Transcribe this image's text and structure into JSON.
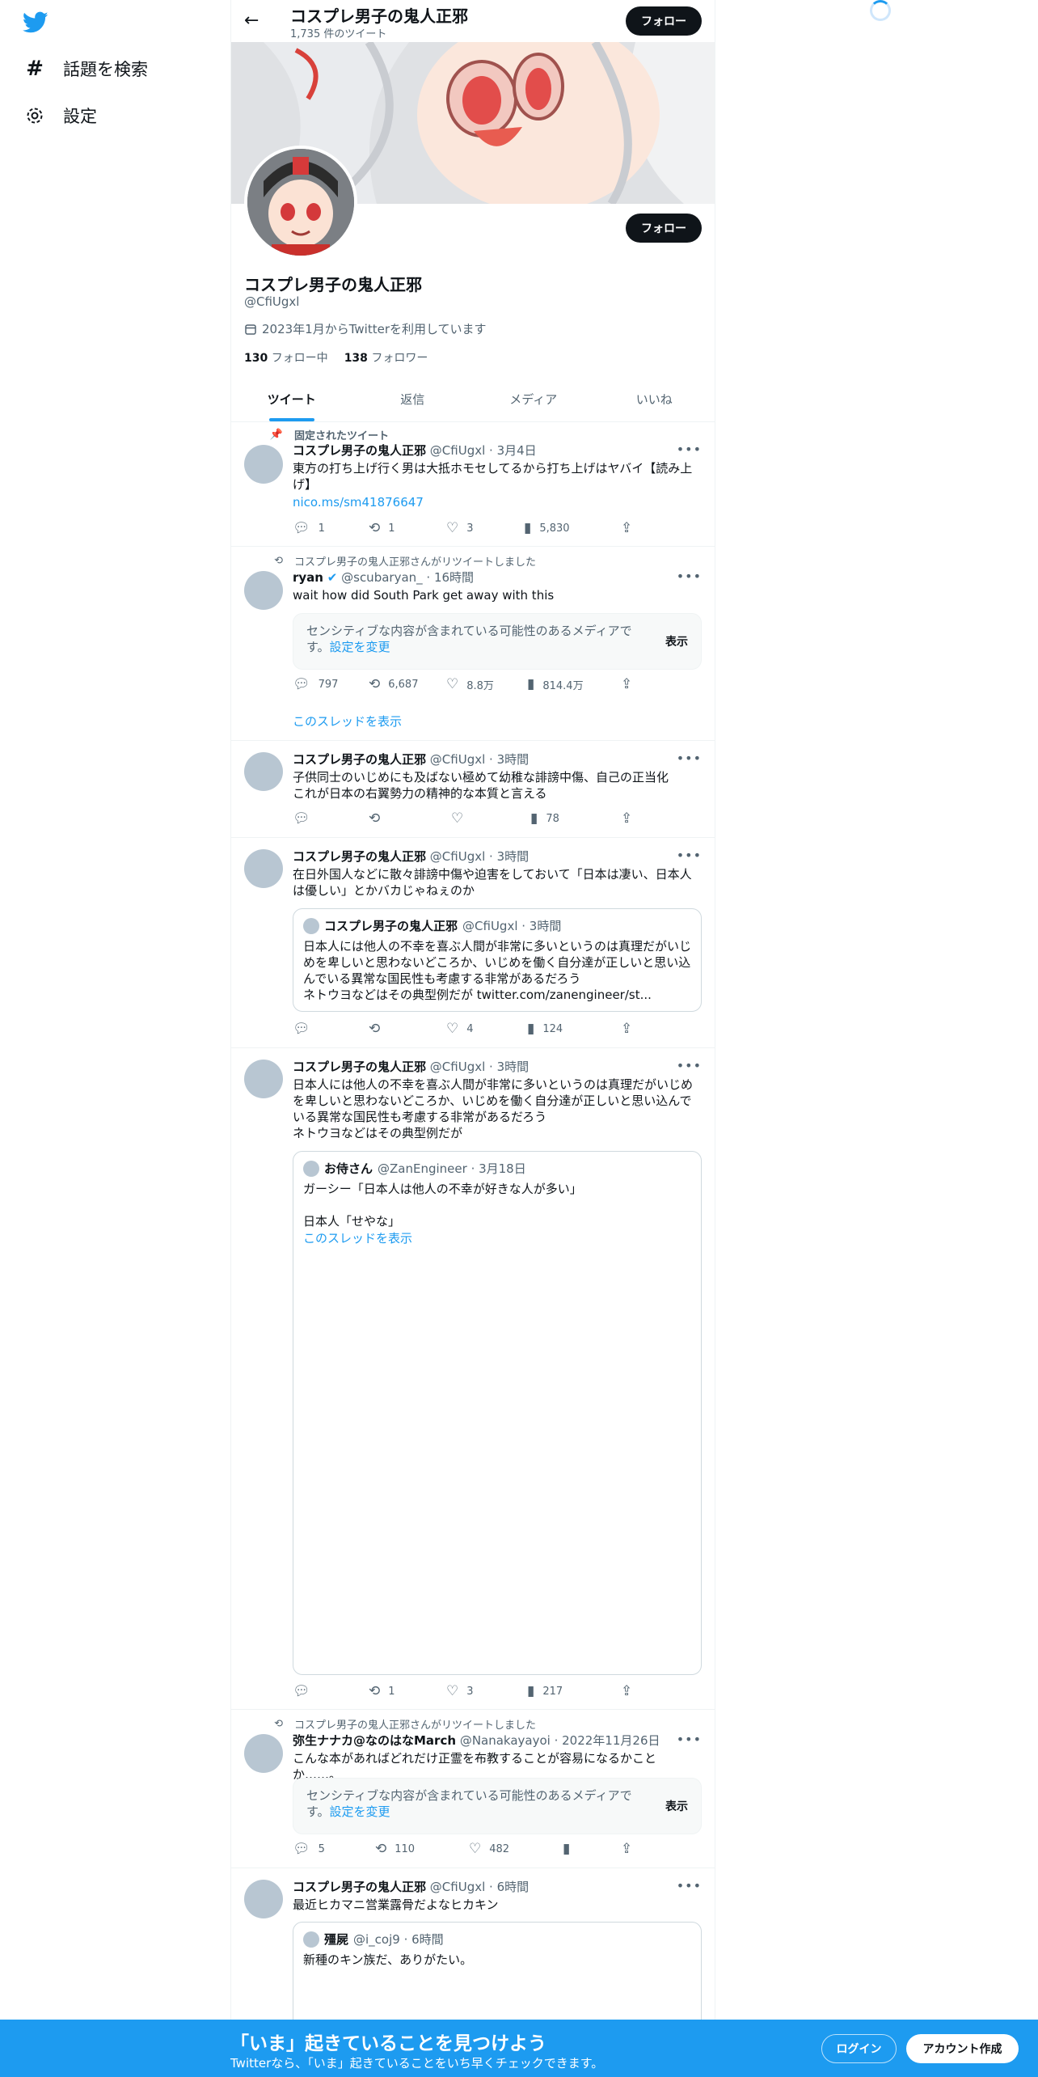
{
  "nav": {
    "items": [
      {
        "label": "話題を検索",
        "icon": "hashtag-icon"
      },
      {
        "label": "設定",
        "icon": "gear-icon"
      }
    ]
  },
  "header": {
    "name": "コスプレ男子の鬼人正邪",
    "tweet_count": "1,735 件のツイート",
    "follow_label": "フォロー"
  },
  "profile": {
    "name": "コスプレ男子の鬼人正邪",
    "handle": "@CfiUgxl",
    "joined": "2023年1月からTwitterを利用しています",
    "following_count": "130",
    "following_label": "フォロー中",
    "followers_count": "138",
    "followers_label": "フォロワー",
    "follow_label": "フォロー"
  },
  "tabs": [
    "ツイート",
    "返信",
    "メディア",
    "いいね"
  ],
  "tweets": [
    {
      "context": "固定されたツイート",
      "name": "コスプレ男子の鬼人正邪",
      "meta": "@CfiUgxl · 3月4日",
      "text": "東方の打ち上げ行く男は大抵ホモセしてるから打ち上げはヤバイ【読み上げ】",
      "link": "nico.ms/sm41876647",
      "replies": "1",
      "retweets": "1",
      "likes": "3",
      "views": "5,830"
    },
    {
      "context": "コスプレ男子の鬼人正邪さんがリツイートしました",
      "name": "ryan",
      "meta": "@scubaryan_ · 16時間",
      "text": "wait how did South Park get away with this",
      "sensitive_text": "センシティブな内容が含まれている可能性のあるメディアです。",
      "sensitive_link": "設定を変更",
      "sensitive_button": "表示",
      "replies": "797",
      "retweets": "6,687",
      "likes": "8.8万",
      "views": "814.4万",
      "show_thread": "このスレッドを表示"
    },
    {
      "name": "コスプレ男子の鬼人正邪",
      "meta": "@CfiUgxl · 3時間",
      "text": "子供同士のいじめにも及ばない極めて幼稚な誹謗中傷、自己の正当化\nこれが日本の右翼勢力の精神的な本質と言える",
      "views": "78"
    },
    {
      "name": "コスプレ男子の鬼人正邪",
      "meta": "@CfiUgxl · 3時間",
      "text": "在日外国人などに散々誹謗中傷や迫害をしておいて「日本は凄い、日本人は優しい」とかバカじゃねぇのか",
      "quote": {
        "name": "コスプレ男子の鬼人正邪",
        "meta": "@CfiUgxl · 3時間",
        "text": "日本人には他人の不幸を喜ぶ人間が非常に多いというのは真理だがいじめを卑しいと思わないどころか、いじめを働く自分達が正しいと思い込んでいる異常な国民性も考慮する非常があるだろう\nネトウヨなどはその典型例だが twitter.com/zanengineer/st..."
      },
      "likes": "4",
      "views": "124"
    },
    {
      "name": "コスプレ男子の鬼人正邪",
      "meta": "@CfiUgxl · 3時間",
      "text": "日本人には他人の不幸を喜ぶ人間が非常に多いというのは真理だがいじめを卑しいと思わないどころか、いじめを働く自分達が正しいと思い込んでいる異常な国民性も考慮する非常があるだろう\nネトウヨなどはその典型例だが",
      "quote": {
        "name": "お侍さん",
        "meta": "@ZanEngineer · 3月18日",
        "text": "ガーシー「日本人は他人の不幸が好きな人が多い」\n\n日本人「せやな」",
        "show_thread": "このスレッドを表示"
      },
      "retweets": "1",
      "likes": "3",
      "views": "217"
    },
    {
      "context": "コスプレ男子の鬼人正邪さんがリツイートしました",
      "name": "弥生ナナカ@なのはなMarch",
      "meta": "@Nanakayayoi · 2022年11月26日",
      "text": "こんな本があればどれだけ正霊を布教することが容易になるかことか……。",
      "sensitive_text": "センシティブな内容が含まれている可能性のあるメディアです。",
      "sensitive_link": "設定を変更",
      "sensitive_button": "表示",
      "replies": "5",
      "retweets": "110",
      "likes": "482"
    },
    {
      "name": "コスプレ男子の鬼人正邪",
      "meta": "@CfiUgxl · 6時間",
      "text": "最近ヒカマニ営業露骨だよなヒカキン",
      "quote": {
        "name": "殭屍",
        "meta": "@i_coj9 · 6時間",
        "text": "新種のキン族だ、ありがたい。"
      }
    }
  ],
  "bottombar": {
    "title": "「いま」起きていることを見つけよう",
    "subtitle": "Twitterなら、「いま」起きていることをいち早くチェックできます。",
    "login": "ログイン",
    "signup": "アカウント作成"
  },
  "colors": {
    "accent": "#1d9bf0",
    "text": "#0f1419",
    "muted": "#536471"
  }
}
